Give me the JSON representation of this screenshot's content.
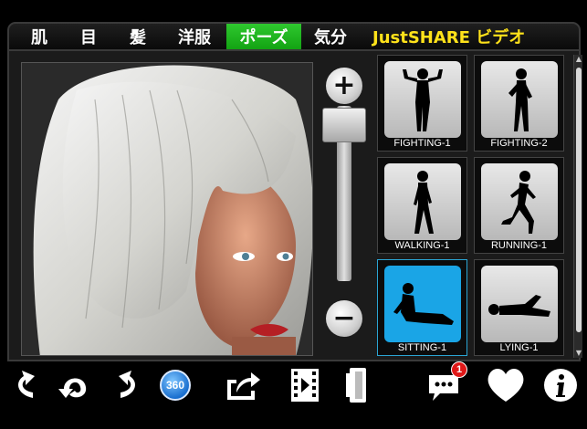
{
  "tabs": [
    {
      "label": "肌",
      "active": false
    },
    {
      "label": "目",
      "active": false
    },
    {
      "label": "髪",
      "active": false
    },
    {
      "label": "洋服",
      "active": false
    },
    {
      "label": "ポーズ",
      "active": true
    },
    {
      "label": "気分",
      "active": false
    },
    {
      "label": "JustSHARE ビデオ",
      "active": false
    }
  ],
  "zoom": {
    "plus_label": "+",
    "minus_label": "−",
    "level": 0.97
  },
  "poses": [
    {
      "label": "FIGHTING-1",
      "icon": "fighting-pose-icon",
      "selected": false
    },
    {
      "label": "FIGHTING-2",
      "icon": "fighting-pose-icon",
      "selected": false
    },
    {
      "label": "WALKING-1",
      "icon": "walking-pose-icon",
      "selected": false
    },
    {
      "label": "RUNNING-1",
      "icon": "running-pose-icon",
      "selected": false
    },
    {
      "label": "SITTING-1",
      "icon": "sitting-pose-icon",
      "selected": true
    },
    {
      "label": "LYING-1",
      "icon": "lying-pose-icon",
      "selected": false
    }
  ],
  "toolbar": {
    "rotate_360_label": "360",
    "chat_badge_count": "1",
    "icons": [
      "rotate-left-icon",
      "reset-icon",
      "rotate-right-icon",
      "rotate-360-icon",
      "share-icon",
      "video-icon",
      "film-icon",
      "chat-icon",
      "heart-icon",
      "info-icon"
    ]
  },
  "colors": {
    "active_tab": "#19b319",
    "share_tab_text": "#ffe21a",
    "selected_pose": "#1aa5e6",
    "badge": "#e01818"
  }
}
